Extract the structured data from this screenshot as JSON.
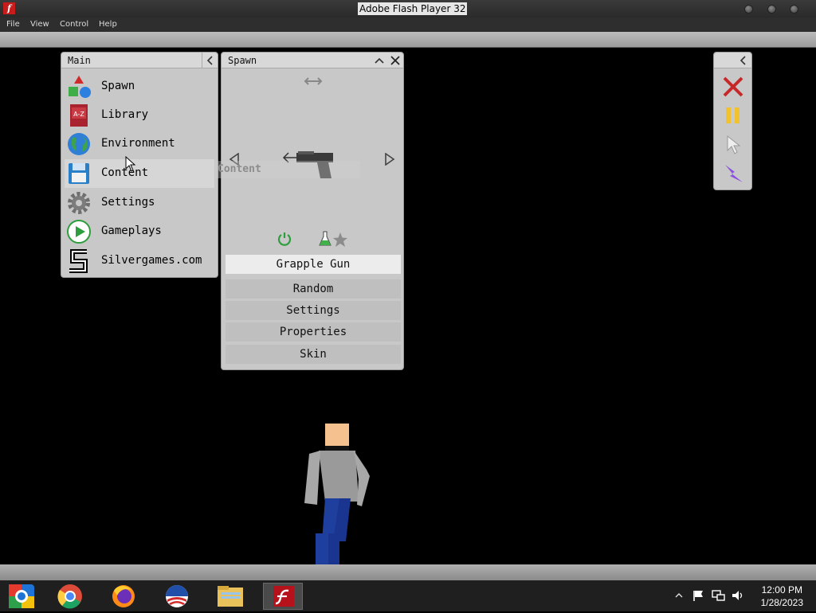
{
  "window": {
    "title": "Adobe Flash Player 32",
    "icon": "flash-icon",
    "icon_glyph": "f"
  },
  "menu": {
    "items": [
      "File",
      "View",
      "Control",
      "Help"
    ]
  },
  "main_panel": {
    "title": "Main",
    "items": [
      {
        "label": "Spawn",
        "icon": "shapes-icon"
      },
      {
        "label": "Library",
        "icon": "book-icon"
      },
      {
        "label": "Environment",
        "icon": "globe-icon"
      },
      {
        "label": "Content",
        "icon": "floppy-disk-icon"
      },
      {
        "label": "Settings",
        "icon": "gear-icon"
      },
      {
        "label": "Gameplays",
        "icon": "play-icon"
      },
      {
        "label": "Silvergames.com",
        "icon": "silvergames-logo-icon"
      }
    ],
    "book_glyph": "A-Z"
  },
  "tooltip": "Content",
  "spawn_panel": {
    "title": "Spawn",
    "selected_item": "Grapple Gun",
    "options": [
      "Random",
      "Settings",
      "Properties",
      "Skin"
    ]
  },
  "colors": {
    "accent_red": "#c62828",
    "pause_yellow": "#f2c12e",
    "power_purple": "#8a4fe0",
    "shirt": "#9a9a9a",
    "skin": "#f5c28f",
    "jeans": "#1f3f9e"
  },
  "taskbar": {
    "apps": [
      "internet-explorer-icon",
      "chrome-icon",
      "firefox-icon",
      "obama-logo-icon",
      "file-explorer-icon",
      "flash-player-icon"
    ],
    "active_app": "flash-player-icon",
    "time": "12:00 PM",
    "date": "1/28/2023"
  }
}
